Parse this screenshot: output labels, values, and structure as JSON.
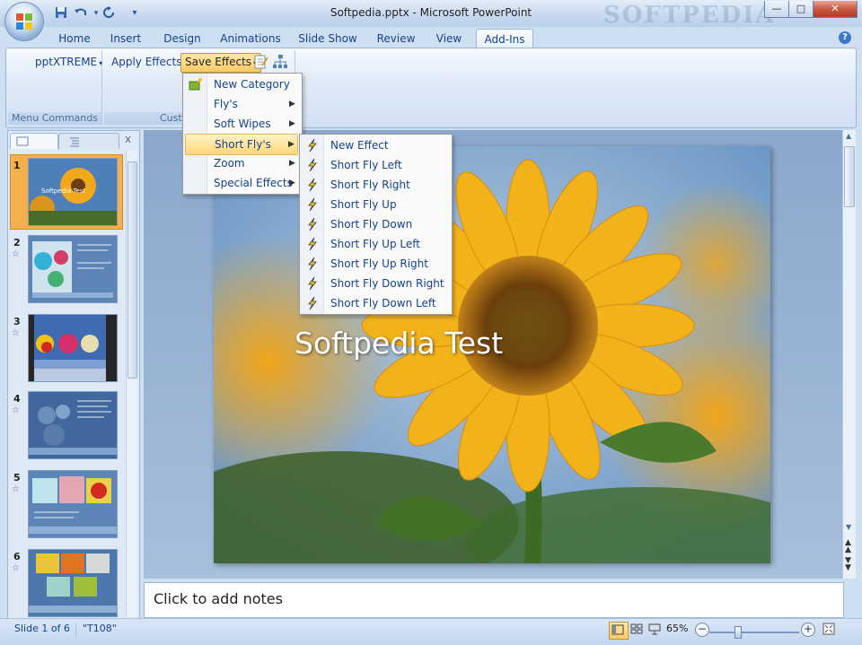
{
  "window": {
    "title": "Softpedia.pptx - Microsoft PowerPoint",
    "watermark": "SOFTPEDIA"
  },
  "qat": {
    "save_icon": "save-icon",
    "undo_icon": "undo-icon",
    "redo_icon": "redo-icon",
    "more": "▾"
  },
  "window_buttons": {
    "minimize": "—",
    "maximize": "□",
    "close": "✕"
  },
  "tabs": [
    {
      "label": "Home"
    },
    {
      "label": "Insert"
    },
    {
      "label": "Design"
    },
    {
      "label": "Animations"
    },
    {
      "label": "Slide Show"
    },
    {
      "label": "Review"
    },
    {
      "label": "View"
    },
    {
      "label": "Add-Ins",
      "active": true
    }
  ],
  "ribbon": {
    "pptxtreme_label": "pptXTREME",
    "apply_effects_label": "Apply Effects",
    "save_effects_label": "Save Effects",
    "group1_label": "Menu Commands",
    "group2_label": "Cust"
  },
  "menu_main": {
    "items": [
      {
        "label": "New Category",
        "has_icon": true,
        "submenu": false
      },
      {
        "label": "Fly's",
        "submenu": true
      },
      {
        "label": "Soft Wipes",
        "submenu": true
      },
      {
        "label": "Short Fly's",
        "submenu": true,
        "highlighted": true
      },
      {
        "label": "Zoom",
        "submenu": true
      },
      {
        "label": "Special Effects",
        "submenu": true
      }
    ]
  },
  "menu_sub": {
    "items": [
      {
        "label": "New Effect"
      },
      {
        "label": "Short Fly Left"
      },
      {
        "label": "Short Fly Right"
      },
      {
        "label": "Short Fly Up"
      },
      {
        "label": "Short Fly Down"
      },
      {
        "label": "Short Fly Up Left"
      },
      {
        "label": "Short Fly Up Right"
      },
      {
        "label": "Short Fly Down Right"
      },
      {
        "label": "Short Fly Down Left"
      }
    ]
  },
  "thumbnails": {
    "close": "x",
    "slides": [
      {
        "num": "1"
      },
      {
        "num": "2"
      },
      {
        "num": "3"
      },
      {
        "num": "4"
      },
      {
        "num": "5"
      },
      {
        "num": "6"
      }
    ],
    "thumb1_title": "Softpedia Test"
  },
  "slide": {
    "title": "Softpedia Test"
  },
  "notes": {
    "placeholder": "Click to add notes"
  },
  "status": {
    "slide_info": "Slide 1 of 6",
    "theme": "\"T108\"",
    "zoom": "65%",
    "zoom_out": "−",
    "zoom_in": "+"
  },
  "colors": {
    "accent": "#15428b",
    "highlight": "#ffd778",
    "thumb_selected": "#f5b04c"
  }
}
